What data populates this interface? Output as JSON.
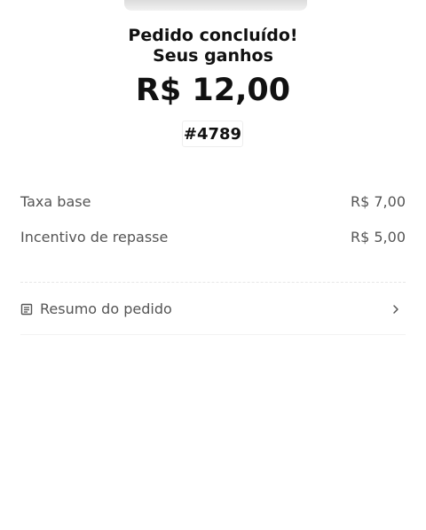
{
  "header": {
    "title_line1": "Pedido concluído!",
    "title_line2": "Seus ganhos",
    "total_amount": "R$ 12,00",
    "order_number": "#4789"
  },
  "earnings": {
    "items": [
      {
        "label": "Taxa base",
        "value": "R$ 7,00"
      },
      {
        "label": "Incentivo de repasse",
        "value": "R$ 5,00"
      }
    ]
  },
  "summary": {
    "label": "Resumo do pedido",
    "icon": "document-icon",
    "chevron_icon": "chevron-right-icon"
  },
  "colors": {
    "primary_text": "#111111",
    "secondary_text": "#555555",
    "background": "#ffffff"
  }
}
